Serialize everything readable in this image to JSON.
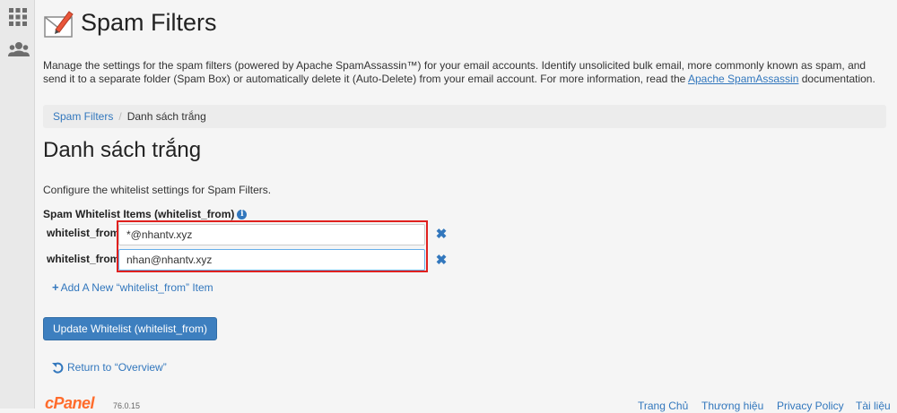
{
  "header": {
    "title": "Spam Filters"
  },
  "description": {
    "text_before": "Manage the settings for the spam filters (powered by Apache SpamAssassin™) for your email accounts. Identify unsolicited bulk email, more commonly known as spam, and send it to a separate folder (Spam Box) or automatically delete it (Auto-Delete) from your email account. For more information, read the ",
    "link": "Apache SpamAssassin",
    "text_after": " documentation."
  },
  "breadcrumb": {
    "items": [
      "Spam Filters",
      "Danh sách trắng"
    ]
  },
  "section": {
    "title": "Danh sách trắng",
    "intro": "Configure the whitelist settings for Spam Filters.",
    "items_label": "Spam Whitelist Items (whitelist_from)"
  },
  "rows": [
    {
      "label": "whitelist_from",
      "value": "*@nhantv.xyz"
    },
    {
      "label": "whitelist_from",
      "value": "nhan@nhantv.xyz"
    }
  ],
  "add_item_label": "Add A New “whitelist_from” Item",
  "update_button": "Update Whitelist (whitelist_from)",
  "return_link": "Return to “Overview”",
  "footer": {
    "brand": "cPanel",
    "version": "76.0.15",
    "links": [
      "Trang Chủ",
      "Thương hiệu",
      "Privacy Policy",
      "Tài liệu"
    ]
  },
  "icons": {
    "sidebar": [
      "grid-icon",
      "users-icon"
    ],
    "app": "envelope-pencil-icon",
    "info": "info-icon",
    "remove": "close-icon",
    "add": "plus-icon",
    "return": "undo-icon"
  },
  "colors": {
    "accent": "#3277bd",
    "button": "#3d7fbf",
    "highlight": "#e0201e",
    "brand": "#ff6c2c"
  }
}
